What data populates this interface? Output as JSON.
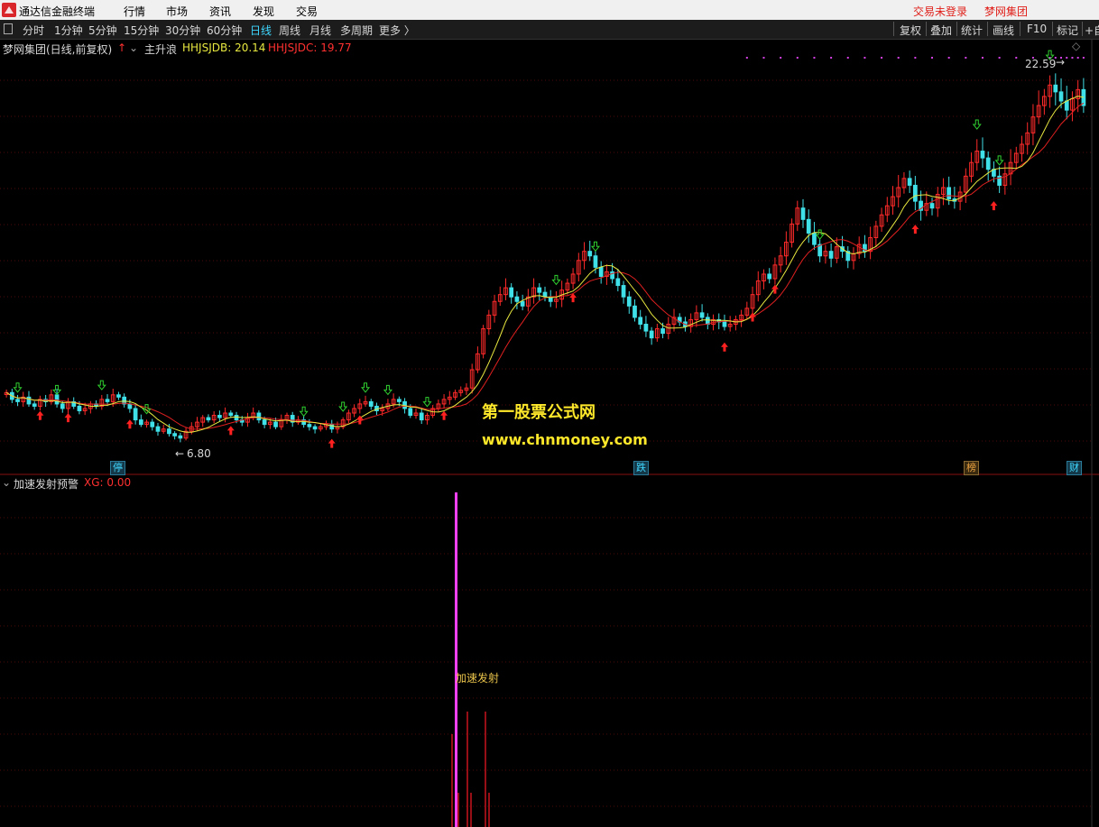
{
  "app": {
    "title": "通达信金融终端",
    "menu": [
      "行情",
      "市场",
      "资讯",
      "发现",
      "交易"
    ],
    "login_status": "交易未登录",
    "account": "梦网集团"
  },
  "toolbar": {
    "periods": [
      "分时",
      "1分钟",
      "5分钟",
      "15分钟",
      "30分钟",
      "60分钟",
      "日线",
      "周线",
      "月线",
      "多周期",
      "更多 〉"
    ],
    "active_period": "日线",
    "right_buttons": [
      "复权",
      "叠加",
      "统计",
      "画线",
      "F10",
      "标记",
      "+自"
    ]
  },
  "main_panel": {
    "stock_label": "梦网集团(日线,前复权)",
    "indicator_name": "主升浪",
    "jdb_label": "HHJSJDB: 20.14",
    "jdc_label": "HHJSJDC: 19.77",
    "high_annotation": "22.59",
    "low_annotation": "6.80",
    "watermark_cn": "第一股票公式网",
    "watermark_url": "www.chnmoney.com",
    "event_markers": [
      "停",
      "跌",
      "榜",
      "财"
    ],
    "colors": {
      "up": "#ff2a2a",
      "down": "#40e0e8",
      "jdb_line": "#e8e840",
      "jdc_line": "#e02020",
      "signal_buy": "#ff2020",
      "signal_sell": "#30d030"
    }
  },
  "sub_panel": {
    "indicator_name": "加速发射预警",
    "xg_label": "XG: 0.00",
    "signal_label": "加速发射",
    "colors": {
      "signal": "#ff40ff",
      "bars": "#c8141e"
    }
  },
  "chart_data": {
    "type": "candlestick",
    "y_range": [
      6,
      23.5
    ],
    "annotations": {
      "high": 22.59,
      "low": 6.8
    },
    "closes": [
      8.8,
      8.5,
      8.4,
      8.6,
      8.3,
      8.2,
      8.5,
      8.4,
      8.7,
      8.3,
      8.1,
      8.4,
      8.2,
      8.0,
      8.1,
      8.3,
      8.2,
      8.5,
      8.4,
      8.7,
      8.6,
      8.3,
      8.1,
      7.6,
      7.4,
      7.5,
      7.3,
      7.1,
      7.2,
      7.0,
      6.9,
      6.8,
      7.1,
      7.3,
      7.5,
      7.7,
      7.6,
      7.8,
      7.7,
      7.9,
      7.8,
      7.6,
      7.5,
      7.7,
      7.9,
      7.6,
      7.4,
      7.5,
      7.3,
      7.6,
      7.8,
      7.5,
      7.6,
      7.4,
      7.3,
      7.2,
      7.3,
      7.4,
      7.2,
      7.3,
      7.6,
      7.9,
      8.1,
      8.3,
      8.4,
      8.2,
      8.0,
      8.1,
      8.3,
      8.5,
      8.4,
      8.1,
      7.8,
      7.9,
      7.6,
      7.8,
      8.1,
      8.3,
      8.5,
      8.6,
      8.8,
      8.9,
      9.0,
      9.8,
      10.5,
      11.6,
      12.2,
      12.8,
      13.1,
      13.4,
      13.0,
      12.8,
      12.6,
      13.0,
      13.4,
      13.2,
      13.0,
      12.8,
      12.9,
      13.3,
      13.6,
      14.0,
      14.6,
      15.0,
      14.8,
      14.3,
      13.9,
      14.1,
      13.8,
      13.5,
      13.0,
      12.6,
      12.1,
      11.8,
      11.5,
      11.2,
      11.6,
      11.4,
      11.8,
      12.1,
      11.9,
      11.7,
      12.0,
      12.3,
      12.1,
      11.8,
      12.0,
      11.9,
      11.7,
      11.8,
      12.0,
      12.2,
      12.5,
      13.1,
      13.7,
      14.0,
      13.8,
      14.4,
      14.8,
      15.4,
      16.2,
      16.9,
      16.4,
      15.8,
      15.3,
      14.8,
      15.0,
      14.7,
      15.2,
      15.0,
      14.6,
      14.9,
      15.3,
      15.0,
      15.6,
      16.1,
      16.6,
      17.0,
      17.4,
      17.8,
      18.2,
      17.9,
      17.2,
      16.8,
      17.1,
      16.9,
      17.5,
      17.8,
      17.3,
      17.2,
      17.6,
      18.3,
      18.9,
      19.4,
      19.1,
      18.6,
      18.3,
      17.9,
      18.4,
      18.9,
      19.3,
      19.7,
      20.2,
      20.9,
      21.4,
      21.8,
      22.3,
      22.0,
      21.6,
      21.2,
      21.7,
      22.1,
      21.4
    ],
    "jdb_last": 20.14,
    "jdc_last": 19.77
  }
}
